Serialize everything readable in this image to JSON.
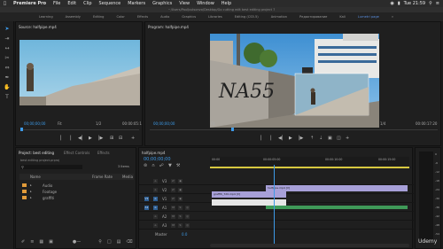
{
  "menubar": {
    "apple": "",
    "app_name": "Premiere Pro",
    "items": [
      "File",
      "Edit",
      "Clip",
      "Sequence",
      "Markers",
      "Graphics",
      "View",
      "Window",
      "Help"
    ],
    "clock": "Tue 21:59",
    "path": "~/Users/PaulJustsonvo/Desktop/Go cutting edit best editing project 7"
  },
  "workspaces": [
    "Learning",
    "Assembly",
    "Editing",
    "Color",
    "Effects",
    "Audio",
    "Graphics",
    "Libraries",
    "Editing (CS5.5)",
    "Animation",
    "Редактирование",
    "Kali",
    "Lumetri page"
  ],
  "source_monitor": {
    "title": "Source: halfpipe.mp4",
    "timecode_left": "00;00;00;00",
    "fit": "Fit",
    "quality": "1/2",
    "timecode_right": "00:00:05:1"
  },
  "program_monitor": {
    "title": "Program: halfpipe.mp4",
    "timecode_left": "00;00;00;00",
    "fit": "Fit",
    "quality": "1/4",
    "timecode_right": "00:00:17:20"
  },
  "project_panel": {
    "tabs": [
      "Project: best editing",
      "Effect Controls",
      "Effects"
    ],
    "project_file": "best editing project.prproj",
    "item_count": "3 Items",
    "col_name": "Name",
    "col_framerate": "Frame Rate",
    "col_media": "Media",
    "items": [
      "Audio",
      "Footage",
      "graffiti"
    ]
  },
  "timeline": {
    "tab": "halfpipe.mp4",
    "timecode": "00;00;00;00",
    "ruler": [
      "00:00",
      "00:00:05:00",
      "00:00:10:00",
      "00:00:15:00"
    ],
    "video_tracks": [
      "V3",
      "V2",
      "V1"
    ],
    "audio_tracks": [
      "A1",
      "A2",
      "A3"
    ],
    "master_label": "Master",
    "master_value": "0.0",
    "clips": {
      "v3": "halfpipe.mp4 [V]",
      "v1": "graffiti_720.mp4 [V]",
      "a1": ""
    }
  },
  "meter_scale": [
    "0",
    "-6",
    "-12",
    "-18",
    "-24",
    "-30",
    "-36",
    "-42",
    "-48",
    "-54"
  ],
  "watermark": "Udemy"
}
